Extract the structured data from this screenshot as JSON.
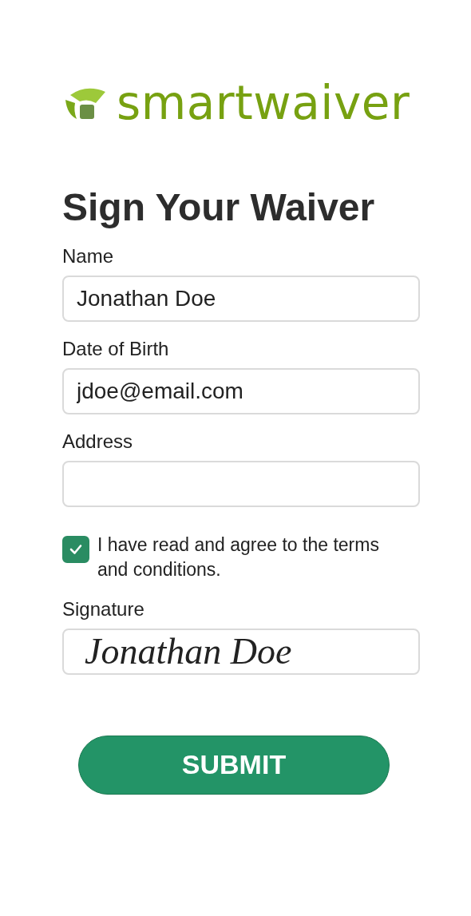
{
  "logo": {
    "text": "smartwaiver"
  },
  "title": "Sign Your Waiver",
  "fields": [
    {
      "label": "Name",
      "value": "Jonathan Doe"
    },
    {
      "label": "Date of Birth",
      "value": "jdoe@email.com"
    },
    {
      "label": "Address"
    }
  ],
  "agreement": {
    "text": "I have read and agree to the terms and conditions.",
    "checked": true
  },
  "signature": {
    "label": "Signature",
    "value": "Jonathan Doe"
  },
  "submit": "SUBMIT"
}
